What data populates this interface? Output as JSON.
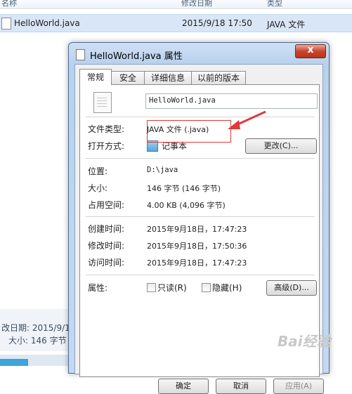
{
  "explorer": {
    "col_name": "名称",
    "col_modified": "修改日期",
    "col_type": "类型",
    "file_name": "HelloWorld.java",
    "file_date": "2015/9/18 17:50",
    "file_type": "JAVA 文件",
    "detail_modified": "改日期: 2015/9/1",
    "detail_size": "大小: 146 字节"
  },
  "dialog": {
    "title": "HelloWorld.java 属性",
    "close_symbol": "x",
    "tabs": [
      {
        "label": "常规"
      },
      {
        "label": "安全"
      },
      {
        "label": "详细信息"
      },
      {
        "label": "以前的版本"
      }
    ],
    "file_name_value": "HelloWorld.java",
    "type_label": "文件类型:",
    "type_value": "JAVA 文件 (.java)",
    "open_with_label": "打开方式:",
    "open_with_value": "记事本",
    "change_button": "更改(C)...",
    "location_label": "位置:",
    "location_value": "D:\\java",
    "size_label": "大小:",
    "size_value": "146 字节 (146 字节)",
    "disk_label": "占用空间:",
    "disk_value": "4.00 KB (4,096 字节)",
    "created_label": "创建时间:",
    "created_value": "2015年9月18日，17:47:23",
    "modified_label": "修改时间:",
    "modified_value": "2015年9月18日，17:50:36",
    "accessed_label": "访问时间:",
    "accessed_value": "2015年9月18日，17:47:23",
    "attributes_label": "属性:",
    "readonly_label": "只读(R)",
    "hidden_label": "隐藏(H)",
    "advanced_button": "高级(D)...",
    "ok_button": "确定",
    "cancel_button": "取消",
    "apply_button": "应用(A)"
  },
  "watermark": "Bai经验",
  "annotation_color": "#e03a3a"
}
